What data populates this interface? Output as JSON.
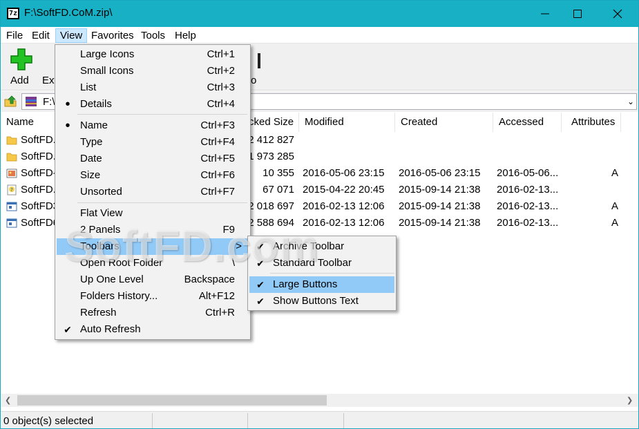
{
  "window": {
    "title": "F:\\SoftFD.CoM.zip\\",
    "app_icon_text": "7z"
  },
  "menubar": {
    "items": [
      "File",
      "Edit",
      "View",
      "Favorites",
      "Tools",
      "Help"
    ],
    "active": "View"
  },
  "toolbar": {
    "buttons": [
      "Add",
      "Ext",
      "o"
    ]
  },
  "address": {
    "path": "F:\\"
  },
  "columns": [
    "Name",
    "Packed Size",
    "Modified",
    "Created",
    "Accessed",
    "Attributes"
  ],
  "columns_visible": [
    "Name",
    "cked Size",
    "Modified",
    "Created",
    "Accessed",
    "Attributes"
  ],
  "files": [
    {
      "name": "SoftFD.",
      "packed": "2 412 827",
      "modified": "",
      "created": "",
      "accessed": "",
      "attr": "",
      "icon": "folder-icon"
    },
    {
      "name": "SoftFD.",
      "packed": "1 973 285",
      "modified": "",
      "created": "",
      "accessed": "",
      "attr": "",
      "icon": "folder-icon"
    },
    {
      "name": "SoftFD-",
      "packed": "10 355",
      "modified": "2016-05-06 23:15",
      "created": "2016-05-06 23:15",
      "accessed": "2016-05-06...",
      "attr": "A",
      "icon": "image-file-icon"
    },
    {
      "name": "SoftFD.",
      "packed": "67 071",
      "modified": "2015-04-22 20:45",
      "created": "2015-09-14 21:38",
      "accessed": "2016-02-13...",
      "attr": "",
      "icon": "help-file-icon"
    },
    {
      "name": "SoftFD3",
      "packed": "2 018 697",
      "modified": "2016-02-13 12:06",
      "created": "2015-09-14 21:38",
      "accessed": "2016-02-13...",
      "attr": "A",
      "icon": "exe-file-icon"
    },
    {
      "name": "SoftFD6",
      "packed": "2 588 694",
      "modified": "2016-02-13 12:06",
      "created": "2015-09-14 21:38",
      "accessed": "2016-02-13...",
      "attr": "A",
      "icon": "exe-file-icon"
    }
  ],
  "view_menu": {
    "items": [
      {
        "label": "Large Icons",
        "shortcut": "Ctrl+1",
        "mark": ""
      },
      {
        "label": "Small Icons",
        "shortcut": "Ctrl+2",
        "mark": ""
      },
      {
        "label": "List",
        "shortcut": "Ctrl+3",
        "mark": ""
      },
      {
        "label": "Details",
        "shortcut": "Ctrl+4",
        "mark": "•"
      },
      {
        "label": "Name",
        "shortcut": "Ctrl+F3",
        "mark": "•"
      },
      {
        "label": "Type",
        "shortcut": "Ctrl+F4",
        "mark": ""
      },
      {
        "label": "Date",
        "shortcut": "Ctrl+F5",
        "mark": ""
      },
      {
        "label": "Size",
        "shortcut": "Ctrl+F6",
        "mark": ""
      },
      {
        "label": "Unsorted",
        "shortcut": "Ctrl+F7",
        "mark": ""
      },
      {
        "label": "Flat View",
        "shortcut": "",
        "mark": ""
      },
      {
        "label": "2 Panels",
        "shortcut": "F9",
        "mark": ""
      },
      {
        "label": "Toolbars",
        "shortcut": ">",
        "mark": ""
      },
      {
        "label": "Open Root Folder",
        "shortcut": "\\",
        "mark": ""
      },
      {
        "label": "Up One Level",
        "shortcut": "Backspace",
        "mark": ""
      },
      {
        "label": "Folders History...",
        "shortcut": "Alt+F12",
        "mark": ""
      },
      {
        "label": "Refresh",
        "shortcut": "Ctrl+R",
        "mark": ""
      },
      {
        "label": "Auto Refresh",
        "shortcut": "",
        "mark": "✔"
      }
    ]
  },
  "toolbars_submenu": {
    "items": [
      {
        "label": "Archive Toolbar",
        "mark": "✔"
      },
      {
        "label": "Standard Toolbar",
        "mark": "✔"
      },
      {
        "label": "Large Buttons",
        "mark": "✔"
      },
      {
        "label": "Show Buttons Text",
        "mark": "✔"
      }
    ]
  },
  "status": {
    "text": "0 object(s) selected"
  },
  "watermark": "SoftFD.com",
  "colors": {
    "titlebar": "#17b0c5",
    "highlight": "#91c9f7",
    "menu_active": "#cce8ff"
  }
}
